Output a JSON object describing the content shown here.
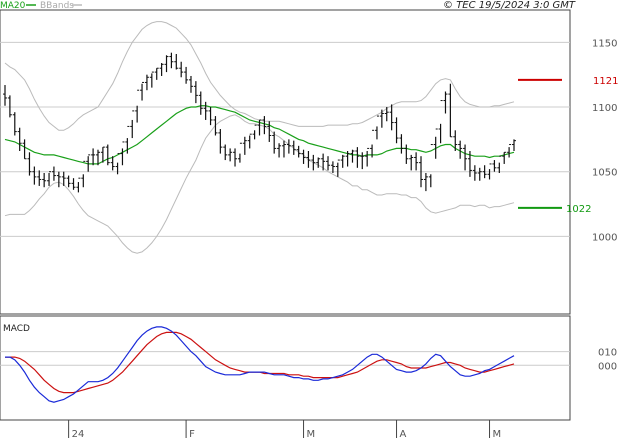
{
  "header": {
    "legend_ma": "MA20",
    "legend_bands": "BBands",
    "copyright": "© TEC 19/5/2024 3:0 GMT"
  },
  "colors": {
    "price_bars": "#111111",
    "ma20": "#1aa01a",
    "bbands": "#bbbbbb",
    "resistance": "#cc0000",
    "support": "#119911",
    "macd_line": "#1a2ad8",
    "signal_line": "#cc1111",
    "grid": "#cccccc"
  },
  "levels": {
    "resistance_label": "1121",
    "support_label": "1022"
  },
  "macd_panel": {
    "title": "MACD"
  },
  "chart_data": [
    {
      "type": "ohlc",
      "title": "",
      "y_ticks": [
        "1150",
        "1100",
        "1050",
        "1000"
      ],
      "x_ticks": [
        "24",
        "F",
        "M",
        "A",
        "M"
      ],
      "ylim": [
        940,
        1175
      ],
      "levels": {
        "resistance": 1121,
        "support": 1022
      },
      "series": [
        {
          "name": "MA20",
          "values": [
            1075,
            1074,
            1073,
            1071,
            1069,
            1067,
            1065,
            1064,
            1063,
            1063,
            1063,
            1062,
            1061,
            1060,
            1059,
            1058,
            1057,
            1056,
            1056,
            1056,
            1058,
            1060,
            1061,
            1063,
            1065,
            1067,
            1069,
            1071,
            1074,
            1077,
            1080,
            1083,
            1086,
            1089,
            1092,
            1095,
            1097,
            1099,
            1100,
            1100,
            1101,
            1101,
            1100,
            1100,
            1099,
            1098,
            1097,
            1096,
            1094,
            1092,
            1090,
            1089,
            1088,
            1087,
            1086,
            1084,
            1083,
            1081,
            1079,
            1077,
            1075,
            1074,
            1072,
            1071,
            1070,
            1069,
            1068,
            1067,
            1066,
            1065,
            1064,
            1063,
            1063,
            1062,
            1063,
            1063,
            1063,
            1064,
            1066,
            1067,
            1068,
            1068,
            1068,
            1067,
            1067,
            1066,
            1065,
            1066,
            1068,
            1070,
            1071,
            1071,
            1068,
            1066,
            1064,
            1063,
            1062,
            1062,
            1062,
            1061,
            1062,
            1062,
            1063,
            1064,
            1065
          ]
        },
        {
          "name": "BBands",
          "values": [
            1134,
            1131,
            1129,
            1125,
            1121,
            1114,
            1106,
            1099,
            1093,
            1088,
            1085,
            1082,
            1082,
            1084,
            1087,
            1091,
            1094,
            1096,
            1098,
            1100,
            1106,
            1112,
            1118,
            1126,
            1135,
            1143,
            1150,
            1155,
            1160,
            1163,
            1165,
            1166,
            1166,
            1165,
            1163,
            1161,
            1157,
            1153,
            1148,
            1141,
            1134,
            1126,
            1119,
            1114,
            1109,
            1105,
            1101,
            1098,
            1096,
            1095,
            1093,
            1091,
            1090,
            1089,
            1089,
            1089,
            1089,
            1088,
            1087,
            1086,
            1085,
            1085,
            1085,
            1085,
            1085,
            1085,
            1086,
            1086,
            1086,
            1086,
            1086,
            1087,
            1087,
            1088,
            1090,
            1092,
            1094,
            1096,
            1099,
            1101,
            1103,
            1104,
            1104,
            1104,
            1104,
            1105,
            1108,
            1113,
            1118,
            1121,
            1122,
            1121,
            1114,
            1108,
            1104,
            1102,
            1101,
            1100,
            1100,
            1100,
            1101,
            1101,
            1102,
            1103,
            1104
          ]
        },
        {
          "name": "BBands",
          "values": [
            1016,
            1017,
            1017,
            1017,
            1017,
            1020,
            1024,
            1029,
            1033,
            1038,
            1041,
            1042,
            1040,
            1036,
            1031,
            1025,
            1020,
            1016,
            1014,
            1012,
            1010,
            1008,
            1004,
            1000,
            995,
            991,
            988,
            987,
            988,
            991,
            995,
            1000,
            1006,
            1013,
            1021,
            1029,
            1037,
            1045,
            1052,
            1059,
            1068,
            1076,
            1081,
            1086,
            1089,
            1091,
            1093,
            1094,
            1092,
            1089,
            1087,
            1087,
            1086,
            1085,
            1083,
            1079,
            1077,
            1074,
            1071,
            1068,
            1065,
            1063,
            1059,
            1057,
            1055,
            1053,
            1050,
            1048,
            1046,
            1044,
            1042,
            1039,
            1039,
            1036,
            1036,
            1034,
            1032,
            1032,
            1033,
            1033,
            1033,
            1032,
            1032,
            1030,
            1030,
            1027,
            1022,
            1019,
            1018,
            1019,
            1020,
            1021,
            1022,
            1024,
            1024,
            1024,
            1023,
            1024,
            1024,
            1022,
            1023,
            1023,
            1024,
            1025,
            1026
          ]
        }
      ],
      "ohlc": {
        "open": [
          1110,
          1107,
          1094,
          1081,
          1072,
          1060,
          1050,
          1046,
          1044,
          1043,
          1050,
          1047,
          1046,
          1045,
          1041,
          1038,
          1045,
          1058,
          1063,
          1063,
          1065,
          1069,
          1057,
          1054,
          1064,
          1073,
          1085,
          1097,
          1113,
          1119,
          1123,
          1127,
          1130,
          1133,
          1139,
          1135,
          1130,
          1127,
          1121,
          1116,
          1109,
          1099,
          1097,
          1090,
          1080,
          1069,
          1063,
          1065,
          1060,
          1072,
          1074,
          1079,
          1086,
          1090,
          1085,
          1078,
          1068,
          1070,
          1071,
          1070,
          1067,
          1064,
          1061,
          1059,
          1057,
          1060,
          1058,
          1055,
          1054,
          1059,
          1062,
          1064,
          1066,
          1062,
          1062,
          1068,
          1082,
          1093,
          1095,
          1096,
          1088,
          1076,
          1068,
          1060,
          1061,
          1057,
          1044,
          1046,
          1071,
          1083,
          1105,
          1110,
          1077,
          1071,
          1068,
          1060,
          1051,
          1049,
          1050,
          1048,
          1056,
          1053,
          1062,
          1065,
          1071
        ],
        "high": [
          1117,
          1109,
          1096,
          1084,
          1075,
          1065,
          1054,
          1051,
          1049,
          1049,
          1054,
          1050,
          1050,
          1047,
          1045,
          1042,
          1048,
          1062,
          1068,
          1067,
          1069,
          1071,
          1062,
          1057,
          1068,
          1076,
          1090,
          1101,
          1118,
          1125,
          1126,
          1130,
          1134,
          1140,
          1142,
          1141,
          1135,
          1131,
          1124,
          1120,
          1112,
          1104,
          1100,
          1093,
          1083,
          1071,
          1068,
          1068,
          1064,
          1077,
          1078,
          1082,
          1090,
          1093,
          1089,
          1081,
          1072,
          1074,
          1075,
          1074,
          1070,
          1067,
          1066,
          1063,
          1061,
          1064,
          1062,
          1058,
          1057,
          1063,
          1066,
          1067,
          1069,
          1065,
          1066,
          1071,
          1085,
          1098,
          1100,
          1102,
          1092,
          1079,
          1071,
          1063,
          1065,
          1062,
          1049,
          1048,
          1077,
          1087,
          1112,
          1118,
          1082,
          1074,
          1071,
          1066,
          1055,
          1053,
          1055,
          1052,
          1059,
          1057,
          1065,
          1069,
          1075
        ],
        "low": [
          1101,
          1092,
          1078,
          1066,
          1060,
          1047,
          1040,
          1039,
          1038,
          1039,
          1043,
          1038,
          1039,
          1038,
          1036,
          1034,
          1038,
          1050,
          1055,
          1055,
          1057,
          1055,
          1051,
          1048,
          1055,
          1064,
          1076,
          1088,
          1105,
          1113,
          1115,
          1121,
          1124,
          1127,
          1130,
          1129,
          1123,
          1118,
          1111,
          1103,
          1094,
          1090,
          1086,
          1078,
          1064,
          1059,
          1058,
          1054,
          1057,
          1063,
          1068,
          1075,
          1078,
          1079,
          1073,
          1064,
          1061,
          1061,
          1064,
          1063,
          1061,
          1056,
          1053,
          1051,
          1053,
          1051,
          1051,
          1049,
          1046,
          1053,
          1054,
          1057,
          1053,
          1052,
          1054,
          1061,
          1075,
          1084,
          1089,
          1082,
          1072,
          1064,
          1056,
          1051,
          1051,
          1038,
          1035,
          1038,
          1060,
          1072,
          1095,
          1077,
          1066,
          1060,
          1051,
          1046,
          1043,
          1043,
          1045,
          1044,
          1050,
          1049,
          1056,
          1061,
          1066
        ],
        "close": [
          1107,
          1094,
          1081,
          1072,
          1060,
          1050,
          1046,
          1044,
          1043,
          1050,
          1047,
          1046,
          1045,
          1041,
          1038,
          1045,
          1058,
          1063,
          1063,
          1065,
          1069,
          1057,
          1054,
          1064,
          1073,
          1085,
          1097,
          1113,
          1119,
          1123,
          1127,
          1130,
          1133,
          1139,
          1135,
          1130,
          1127,
          1121,
          1116,
          1109,
          1099,
          1097,
          1090,
          1080,
          1069,
          1063,
          1065,
          1060,
          1072,
          1074,
          1079,
          1086,
          1090,
          1085,
          1078,
          1068,
          1070,
          1071,
          1070,
          1067,
          1064,
          1061,
          1059,
          1057,
          1060,
          1058,
          1055,
          1054,
          1059,
          1062,
          1064,
          1066,
          1062,
          1062,
          1068,
          1082,
          1093,
          1095,
          1096,
          1088,
          1076,
          1068,
          1060,
          1061,
          1057,
          1044,
          1046,
          1071,
          1083,
          1105,
          1110,
          1077,
          1071,
          1068,
          1060,
          1051,
          1049,
          1050,
          1048,
          1056,
          1053,
          1062,
          1065,
          1071,
          1074
        ]
      }
    },
    {
      "type": "line",
      "title": "MACD",
      "y_ticks": [
        "010",
        "000"
      ],
      "ylim": [
        -40,
        36
      ],
      "series": [
        {
          "name": "",
          "values": [
            6,
            6,
            4,
            0,
            -5,
            -11,
            -16,
            -20,
            -23,
            -26,
            -27,
            -26,
            -25,
            -23,
            -21,
            -18,
            -15,
            -12,
            -12,
            -12,
            -11,
            -9,
            -6,
            -2,
            3,
            8,
            13,
            18,
            22,
            25,
            27,
            28,
            28,
            27,
            25,
            22,
            18,
            14,
            10,
            7,
            3,
            -1,
            -3,
            -5,
            -6,
            -7,
            -7,
            -7,
            -7,
            -6,
            -5,
            -5,
            -5,
            -5,
            -6,
            -7,
            -7,
            -7,
            -8,
            -9,
            -9,
            -10,
            -10,
            -11,
            -11,
            -10,
            -10,
            -9,
            -8,
            -7,
            -5,
            -3,
            0,
            3,
            6,
            8,
            8,
            6,
            3,
            0,
            -3,
            -4,
            -5,
            -5,
            -4,
            -2,
            1,
            5,
            8,
            7,
            3,
            -1,
            -4,
            -7,
            -8,
            -8,
            -7,
            -6,
            -4,
            -3,
            -1,
            1,
            3,
            5,
            7
          ]
        },
        {
          "name": "",
          "values": [
            6,
            6,
            6,
            5,
            3,
            0,
            -3,
            -7,
            -11,
            -14,
            -17,
            -19,
            -20,
            -20,
            -20,
            -19,
            -18,
            -17,
            -16,
            -15,
            -14,
            -13,
            -11,
            -8,
            -5,
            -1,
            3,
            7,
            11,
            15,
            18,
            21,
            23,
            24,
            24,
            24,
            23,
            21,
            19,
            16,
            13,
            10,
            7,
            4,
            2,
            0,
            -2,
            -3,
            -4,
            -5,
            -5,
            -5,
            -5,
            -6,
            -6,
            -6,
            -6,
            -6,
            -7,
            -7,
            -7,
            -8,
            -8,
            -9,
            -9,
            -9,
            -9,
            -9,
            -9,
            -8,
            -7,
            -6,
            -5,
            -3,
            -1,
            1,
            3,
            4,
            4,
            3,
            2,
            1,
            -1,
            -2,
            -2,
            -2,
            -2,
            -1,
            0,
            1,
            2,
            2,
            1,
            0,
            -2,
            -3,
            -4,
            -5,
            -5,
            -4,
            -3,
            -2,
            -1,
            0,
            1
          ]
        }
      ]
    }
  ]
}
